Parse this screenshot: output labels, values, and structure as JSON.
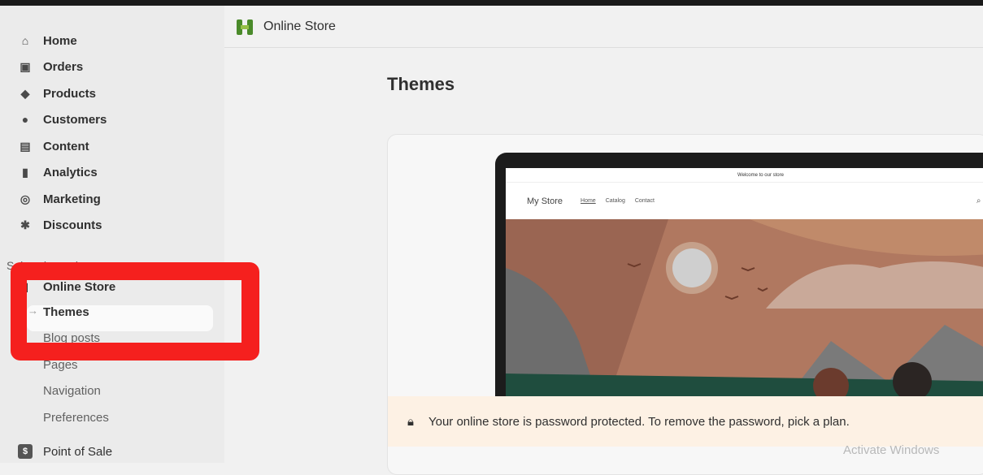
{
  "sidebar": {
    "items": [
      {
        "label": "Home",
        "icon": "home-icon"
      },
      {
        "label": "Orders",
        "icon": "inbox-icon"
      },
      {
        "label": "Products",
        "icon": "tag-icon"
      },
      {
        "label": "Customers",
        "icon": "person-icon"
      },
      {
        "label": "Content",
        "icon": "content-icon"
      },
      {
        "label": "Analytics",
        "icon": "bar-chart-icon"
      },
      {
        "label": "Marketing",
        "icon": "target-icon"
      },
      {
        "label": "Discounts",
        "icon": "discount-icon"
      }
    ],
    "section_label": "Sales channels",
    "online_store": "Online Store",
    "subitems": [
      "Themes",
      "Blog posts",
      "Pages",
      "Navigation",
      "Preferences"
    ],
    "point_of_sale": "Point of Sale"
  },
  "header": {
    "title": "Online Store"
  },
  "page": {
    "title": "Themes"
  },
  "preview": {
    "announcement": "Welcome to our store",
    "brand": "My Store",
    "links": [
      "Home",
      "Catalog",
      "Contact"
    ]
  },
  "banner": {
    "text": "Your online store is password protected. To remove the password, pick a plan."
  },
  "watermark": "Activate Windows",
  "colors": {
    "highlight": "#f5201e",
    "banner_bg": "#fdf1e4"
  }
}
